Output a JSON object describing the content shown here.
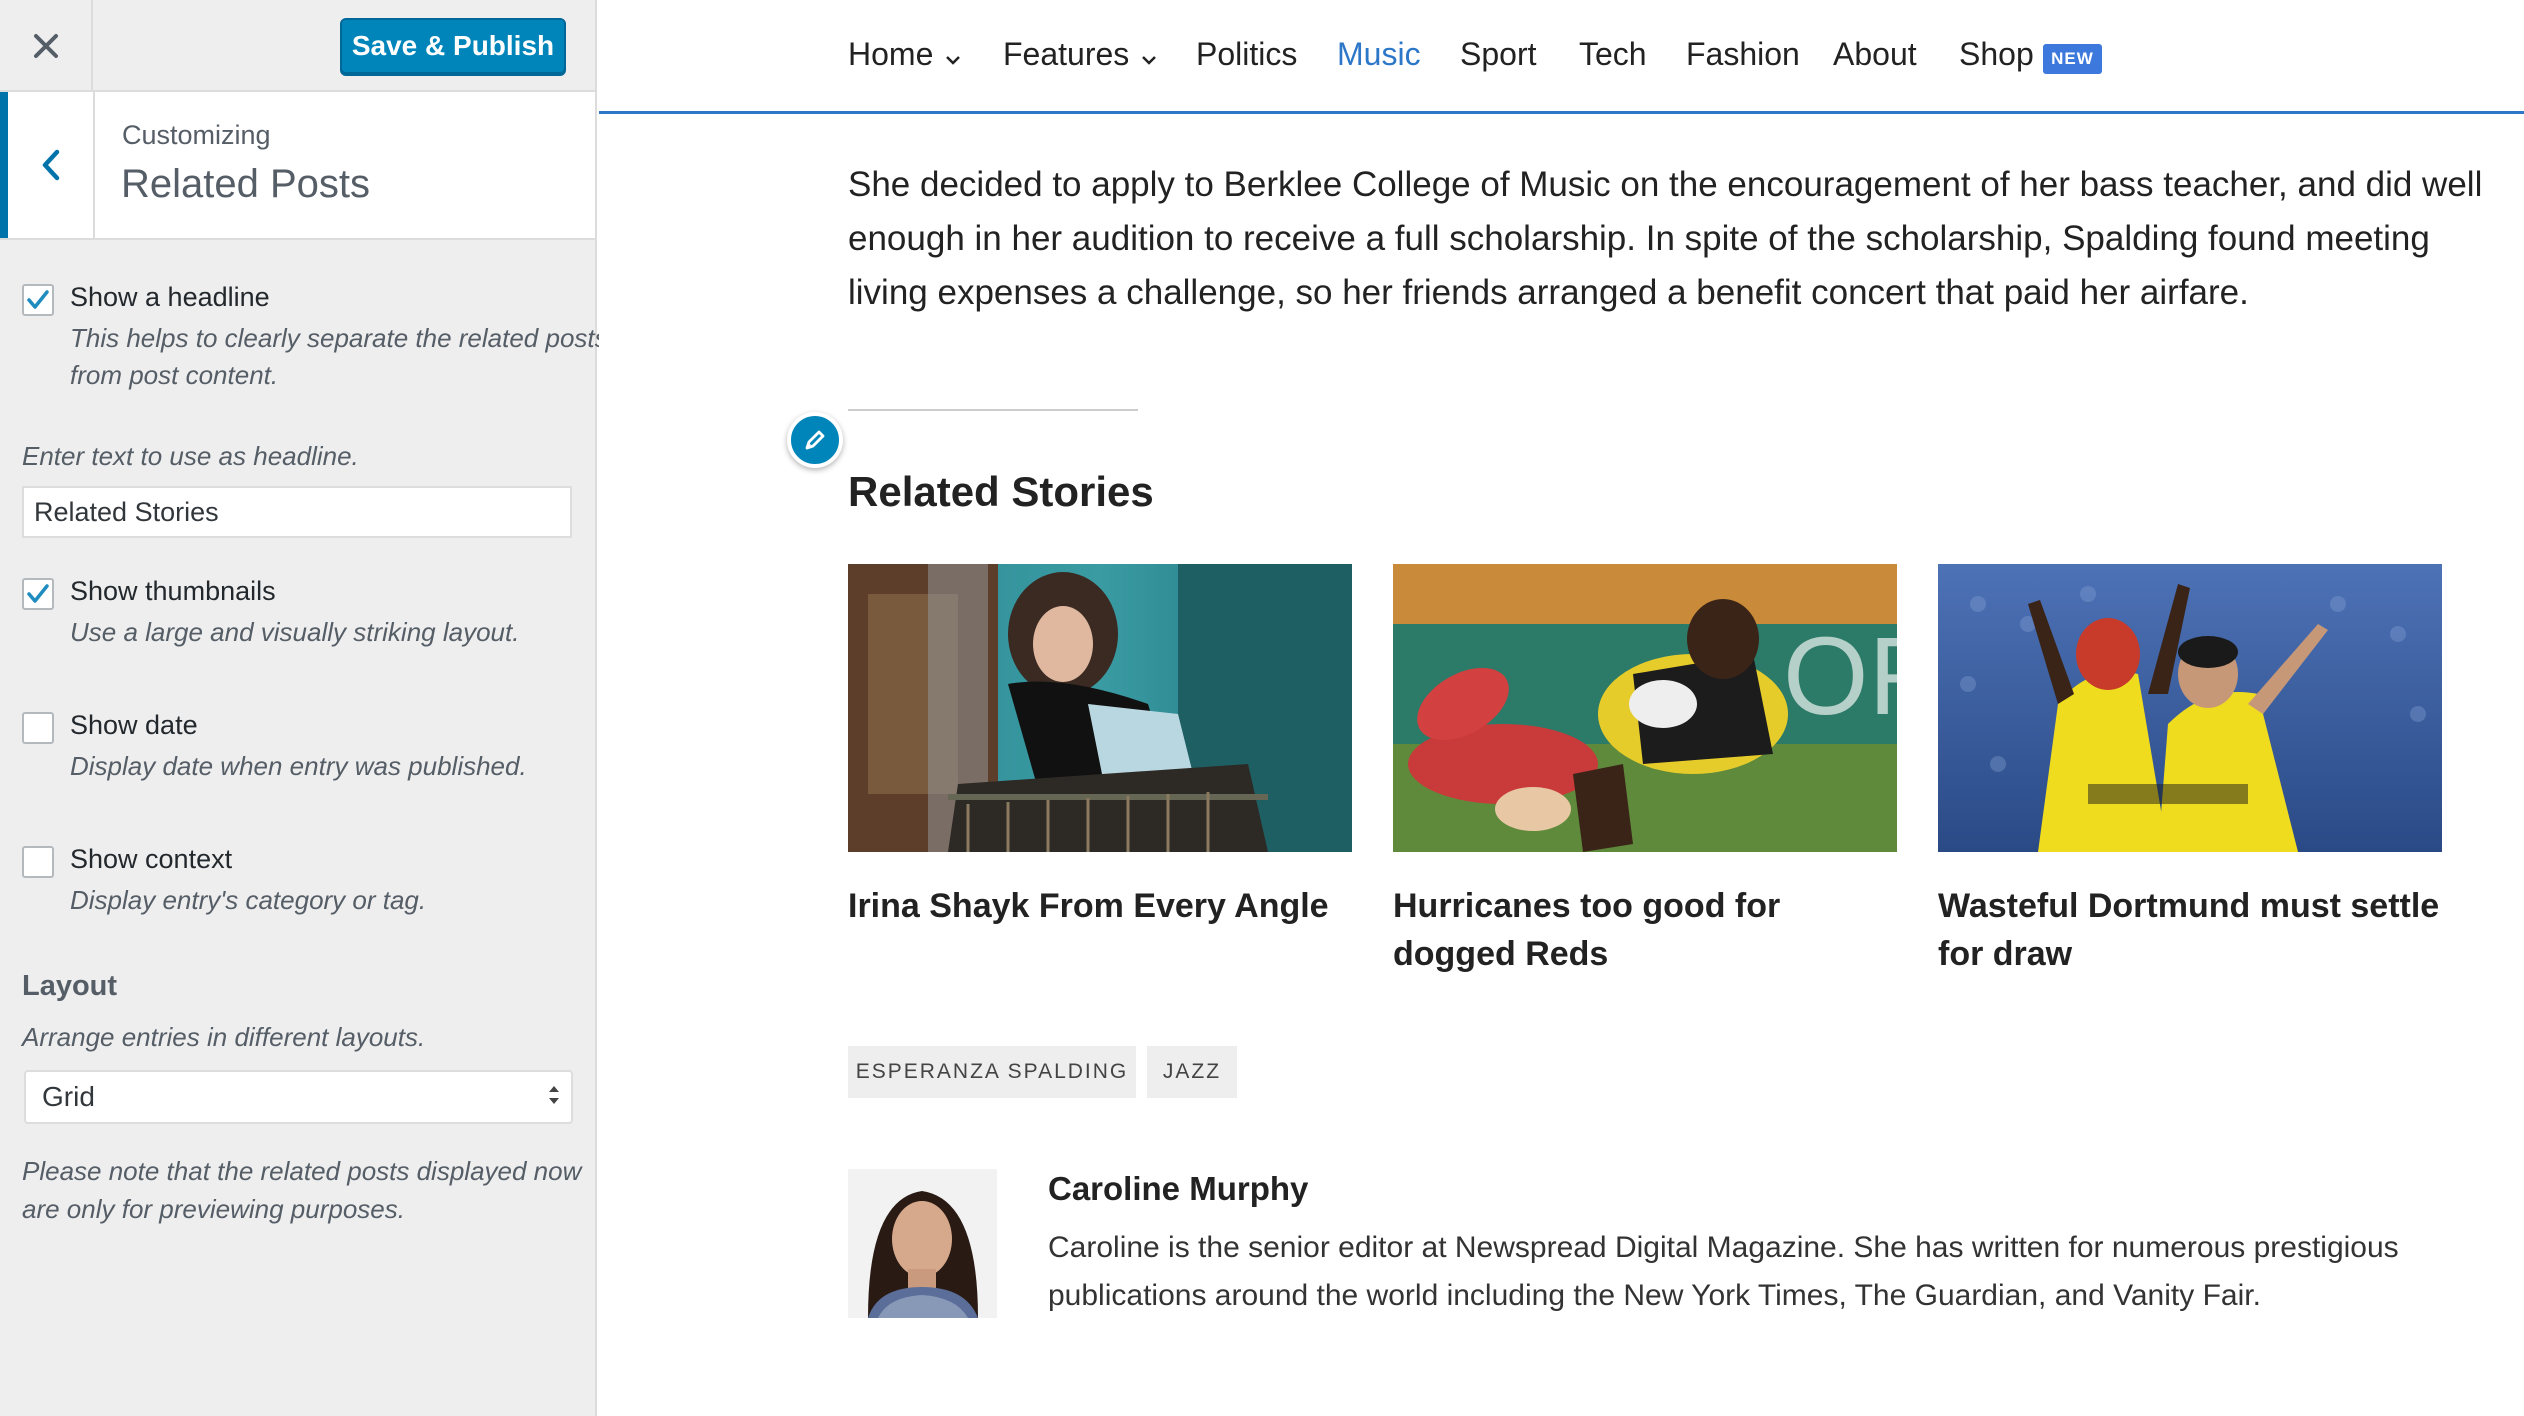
{
  "customizer": {
    "close_icon": "close-icon",
    "save_label": "Save & Publish",
    "breadcrumb": "Customizing",
    "section_title": "Related Posts",
    "accent": "#0085ba",
    "controls": {
      "show_headline": {
        "label": "Show a headline",
        "desc": "This helps to clearly separate the related posts from post content.",
        "checked": true
      },
      "headline_field_label": "Enter text to use as headline.",
      "headline_value": "Related Stories",
      "show_thumbnails": {
        "label": "Show thumbnails",
        "desc": "Use a large and visually striking layout.",
        "checked": true
      },
      "show_date": {
        "label": "Show date",
        "desc": "Display date when entry was published.",
        "checked": false
      },
      "show_context": {
        "label": "Show context",
        "desc": "Display entry's category or tag.",
        "checked": false
      },
      "layout_title": "Layout",
      "layout_desc": "Arrange entries in different layouts.",
      "layout_value": "Grid",
      "note": "Please note that the related posts displayed now are only for previewing purposes."
    }
  },
  "nav": {
    "items": [
      "Home",
      "Features",
      "Politics",
      "Music",
      "Sport",
      "Tech",
      "Fashion",
      "About",
      "Shop"
    ],
    "active": "Music",
    "badge": "NEW",
    "active_color": "#2d77c9"
  },
  "article": {
    "paragraph": "She decided to apply to Berklee College of Music on the encouragement of her bass teacher, and did well enough in her audition to receive a full scholarship. In spite of the scholarship, Spalding found meeting living expenses a challenge, so her friends arranged a benefit concert that paid her airfare.",
    "related_title": "Related Stories",
    "related": [
      {
        "title": "Irina Shayk From Every Angle"
      },
      {
        "title": "Hurricanes too good for dogged Reds"
      },
      {
        "title": "Wasteful Dortmund must settle for draw"
      }
    ],
    "tags": [
      "ESPERANZA SPALDING",
      "JAZZ"
    ],
    "author": {
      "name": "Caroline Murphy",
      "bio": "Caroline is the senior editor at Newspread Digital Magazine. She has written for numerous prestigious publications around the world including the New York Times, The Guardian, and Vanity Fair."
    }
  }
}
